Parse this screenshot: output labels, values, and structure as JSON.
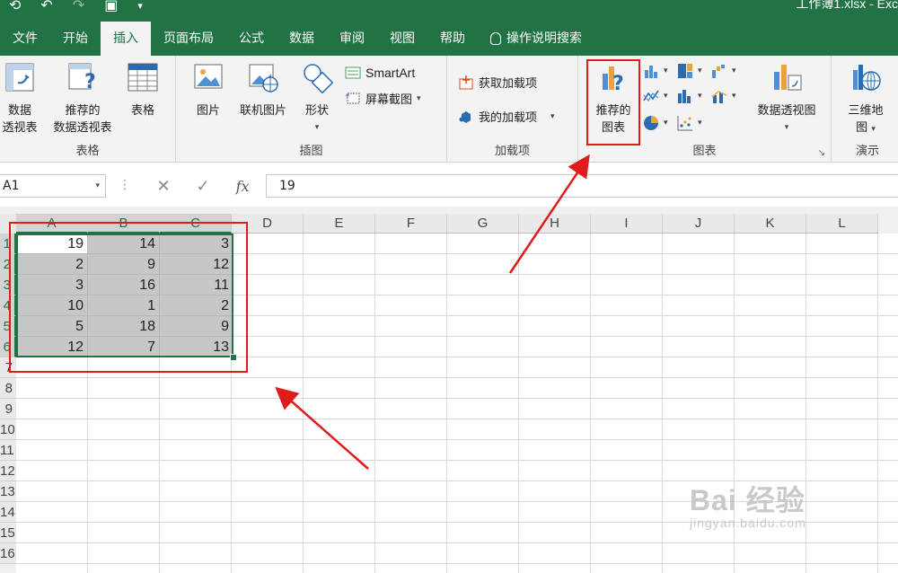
{
  "window": {
    "document_title": "工作簿1.xlsx  -  Exc"
  },
  "tabs": [
    "文件",
    "开始",
    "插入",
    "页面布局",
    "公式",
    "数据",
    "审阅",
    "视图",
    "帮助"
  ],
  "active_tab": "插入",
  "tell_me": "操作说明搜索",
  "ribbon": {
    "groups": {
      "tables": {
        "label": "表格",
        "pivot": [
          "数据",
          "透视表"
        ],
        "recommended_pivot": [
          "推荐的",
          "数据透视表"
        ],
        "table": "表格"
      },
      "illustrations": {
        "label": "插图",
        "pictures": "图片",
        "online_pictures": "联机图片",
        "shapes": "形状",
        "smartart": "SmartArt",
        "screenshot": "屏幕截图"
      },
      "addins": {
        "label": "加载项",
        "get_addins": "获取加载项",
        "my_addins": "我的加载项"
      },
      "charts": {
        "label": "图表",
        "recommended_charts": [
          "推荐的",
          "图表"
        ],
        "pivot_chart": "数据透视图"
      },
      "tours": {
        "label": "演示",
        "map_3d": [
          "三维地",
          "图"
        ]
      }
    }
  },
  "formula_bar": {
    "name_box": "A1",
    "fx": "fx",
    "value": "19"
  },
  "columns": [
    "A",
    "B",
    "C",
    "D",
    "E",
    "F",
    "G",
    "H",
    "I",
    "J",
    "K",
    "L"
  ],
  "rows": [
    "1",
    "2",
    "3",
    "4",
    "5",
    "6",
    "7",
    "8",
    "9",
    "10",
    "11",
    "12",
    "13",
    "14",
    "15",
    "16"
  ],
  "cells": [
    [
      "19",
      "14",
      "3"
    ],
    [
      "2",
      "9",
      "12"
    ],
    [
      "3",
      "16",
      "11"
    ],
    [
      "10",
      "1",
      "2"
    ],
    [
      "5",
      "18",
      "9"
    ],
    [
      "12",
      "7",
      "13"
    ]
  ],
  "annotation_color": "#e01b1b",
  "accent_color": "#217346",
  "watermark": {
    "brand": "Bai 经验",
    "url": "jingyan.baidu.com"
  }
}
